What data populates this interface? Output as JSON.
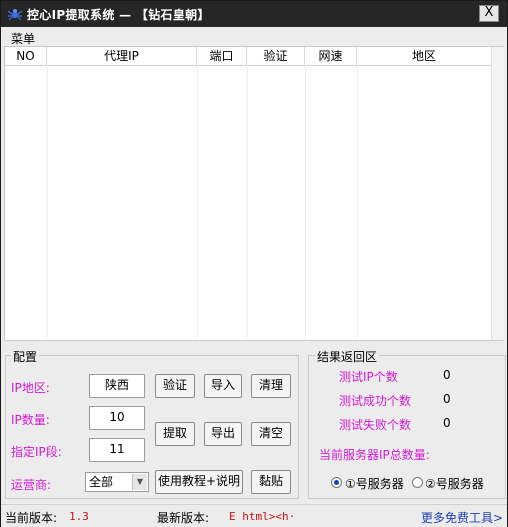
{
  "window": {
    "title": "控心IP提取系统 — 【钻石皇朝】",
    "close_glyph": "X"
  },
  "menu": {
    "label": "菜单"
  },
  "table": {
    "columns": [
      "NO",
      "代理IP",
      "端口",
      "验证",
      "网速",
      "地区"
    ]
  },
  "config": {
    "title": "配置",
    "region_label": "IP地区:",
    "region_value": "陕西",
    "count_label": "IP数量:",
    "count_value": "10",
    "segment_label": "指定IP段:",
    "segment_value": "11",
    "carrier_label": "运营商:",
    "carrier_value": "全部",
    "buttons": {
      "verify": "验证",
      "import": "导入",
      "clear": "清理",
      "extract": "提取",
      "export": "导出",
      "empty": "清空",
      "tutorial": "使用教程+说明",
      "paste": "黏贴"
    }
  },
  "results": {
    "title": "结果返回区",
    "tested_label": "测试IP个数",
    "tested_value": "0",
    "success_label": "测试成功个数",
    "success_value": "0",
    "fail_label": "测试失败个数",
    "fail_value": "0",
    "server_total_label": "当前服务器IP总数量:",
    "server1": "①号服务器",
    "server2": "②号服务器",
    "selected_server": 1
  },
  "status": {
    "current_label": "当前版本:",
    "current_value": "1.3",
    "latest_label": "最新版本:",
    "latest_value": "E html><h·",
    "more_tools": "更多免费工具>"
  },
  "colors": {
    "titlebar": "#262626",
    "label_magenta": "#d21ad2",
    "version_red": "#cc1010",
    "link_blue": "#1f3fb4"
  }
}
